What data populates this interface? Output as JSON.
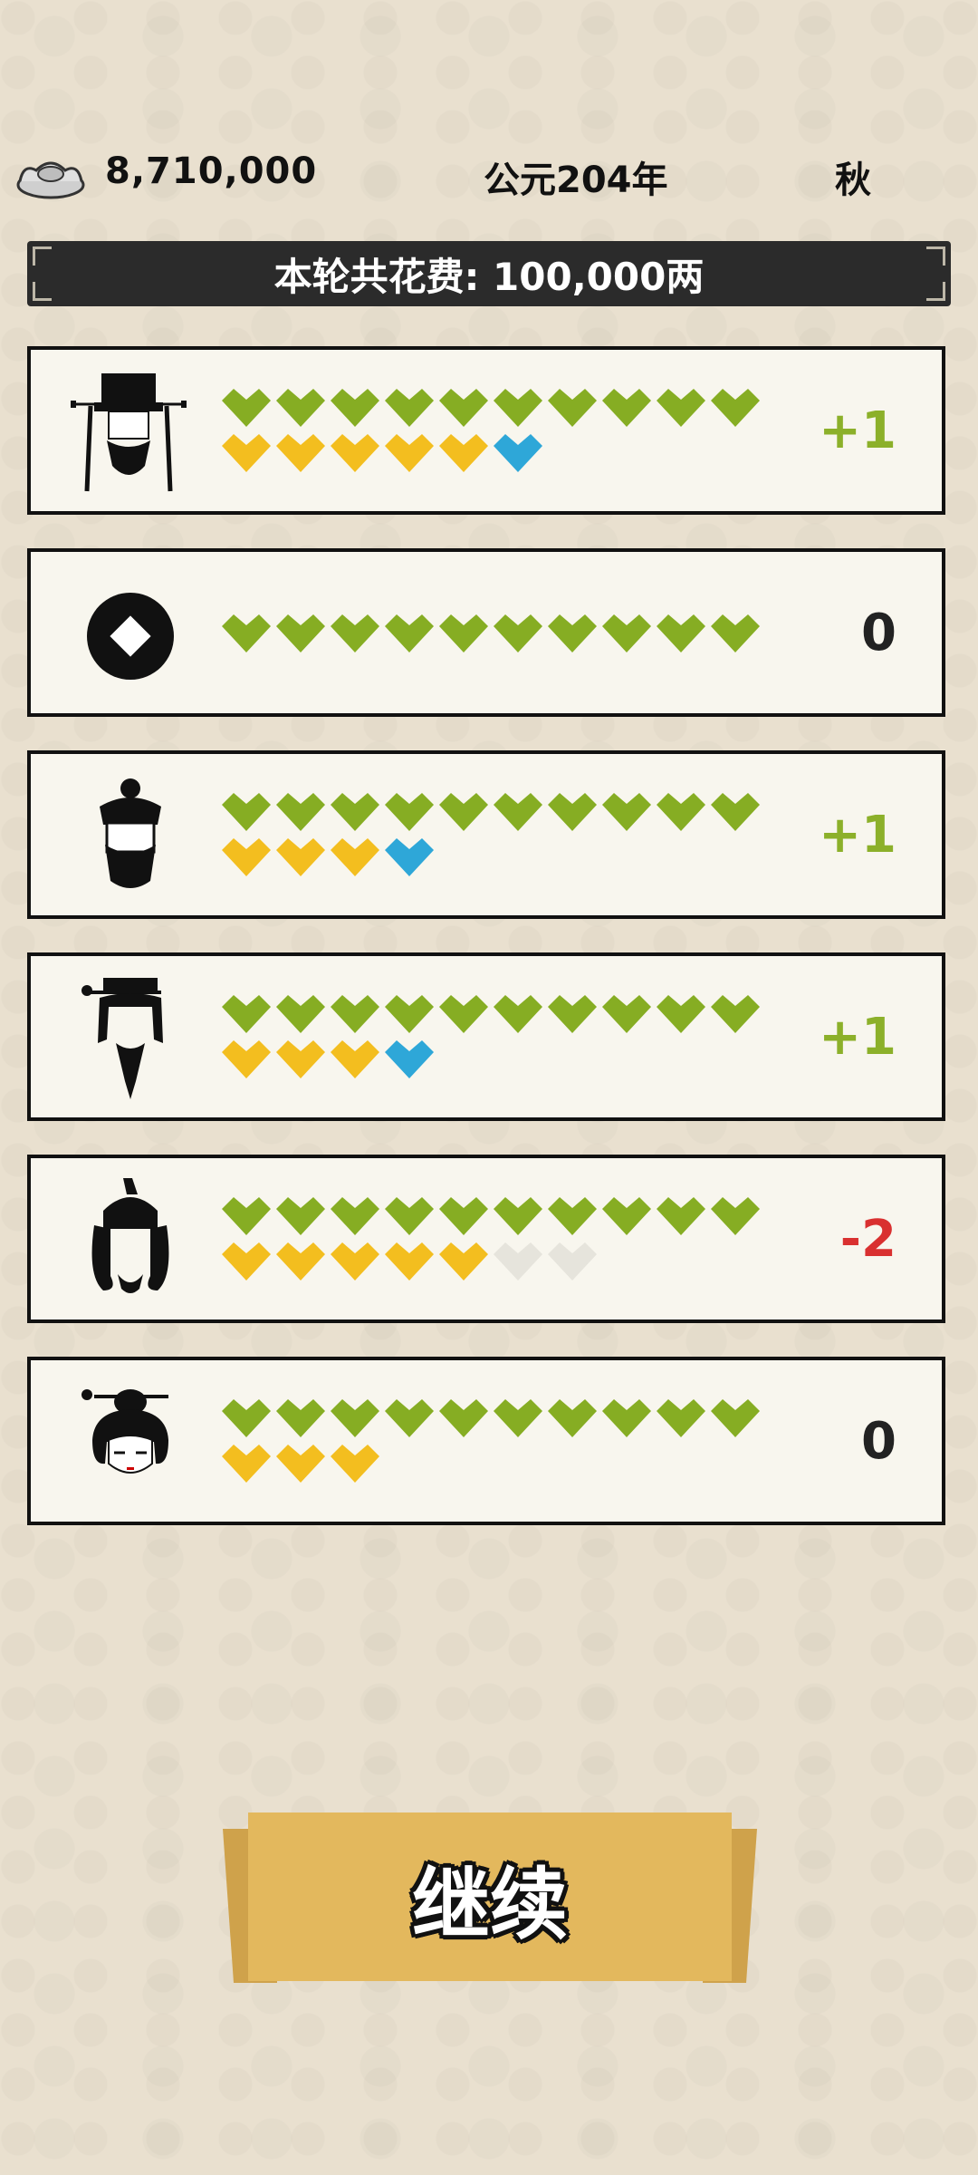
{
  "header": {
    "money": "8,710,000",
    "year": "公元204年",
    "season": "秋",
    "icon": "silver-ingot-icon"
  },
  "banner": {
    "text": "本轮共花费: 100,000两"
  },
  "colors": {
    "green": "#86ad23",
    "yellow": "#f3be1f",
    "blue": "#2ea7d8",
    "empty": "#e6e4dc",
    "positive": "#8cb02a",
    "negative": "#d93030",
    "neutral": "#222222"
  },
  "rows": [
    {
      "portrait": "official-hat-icon",
      "green": 10,
      "row2": [
        "yellow",
        "yellow",
        "yellow",
        "yellow",
        "yellow",
        "blue"
      ],
      "delta": "+1",
      "tone": "positive"
    },
    {
      "portrait": "coin-icon",
      "green": 10,
      "row2": [],
      "delta": "0",
      "tone": "neutral"
    },
    {
      "portrait": "topknot-man-icon",
      "green": 10,
      "row2": [
        "yellow",
        "yellow",
        "yellow",
        "blue"
      ],
      "delta": "+1",
      "tone": "positive"
    },
    {
      "portrait": "scholar-icon",
      "green": 10,
      "row2": [
        "yellow",
        "yellow",
        "yellow",
        "blue"
      ],
      "delta": "+1",
      "tone": "positive"
    },
    {
      "portrait": "warrior-helmet-icon",
      "green": 10,
      "row2": [
        "yellow",
        "yellow",
        "yellow",
        "yellow",
        "yellow",
        "empty",
        "empty"
      ],
      "delta": "-2",
      "tone": "negative"
    },
    {
      "portrait": "lady-icon",
      "green": 10,
      "row2": [
        "yellow",
        "yellow",
        "yellow"
      ],
      "delta": "0",
      "tone": "neutral"
    }
  ],
  "continue_button": {
    "label": "继续"
  }
}
